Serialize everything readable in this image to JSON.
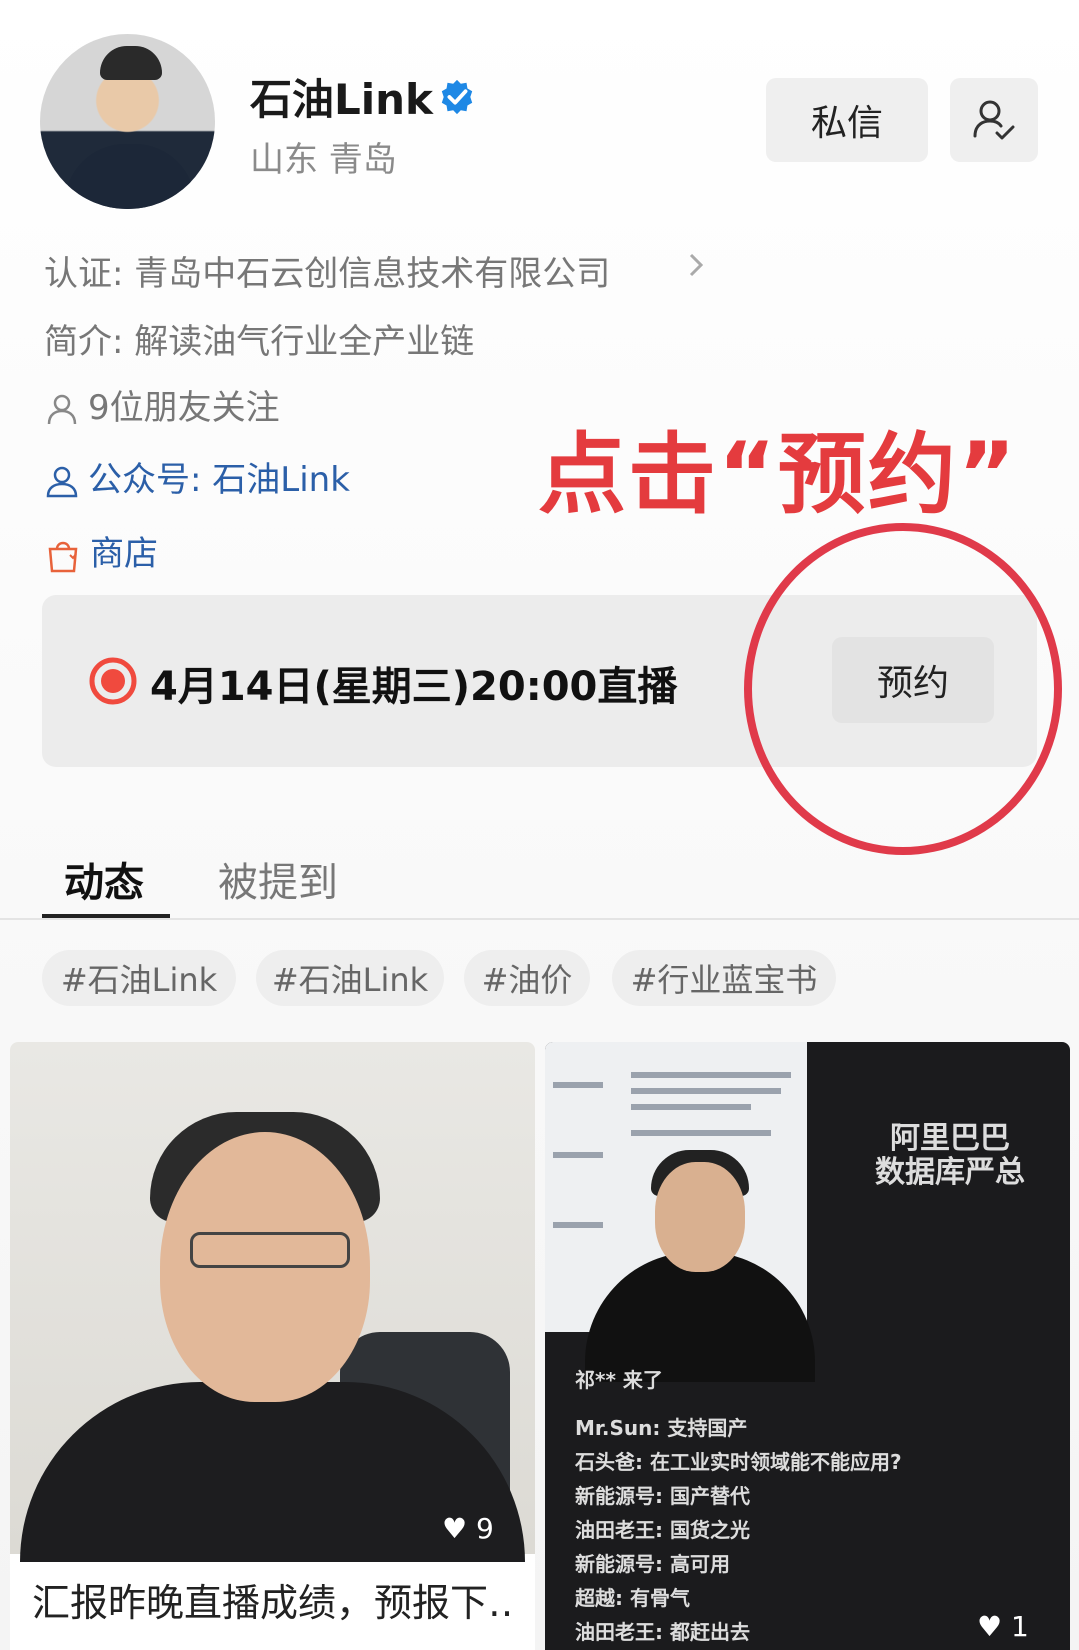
{
  "profile": {
    "name": "石油Link",
    "location": "山东 青岛",
    "message_button": "私信",
    "verification": "认证: 青岛中石云创信息技术有限公司",
    "intro": "简介: 解读油气行业全产业链",
    "friends_follow": "9位朋友关注",
    "official_account": "公众号: 石油Link",
    "shop": "商店"
  },
  "annotation": {
    "text": "点击“预约”",
    "color": "#e43b3e"
  },
  "live": {
    "schedule": "4月14日(星期三)20:00直播",
    "reserve_button": "预约"
  },
  "tabs": [
    {
      "label": "动态",
      "active": true
    },
    {
      "label": "被提到",
      "active": false
    }
  ],
  "tags": [
    "#石油Link",
    "#石油Link",
    "#油价",
    "#行业蓝宝书"
  ],
  "videos": [
    {
      "caption": "汇报昨晚直播成绩，预报下…",
      "likes": "9"
    },
    {
      "likes": "1",
      "overlay_title": [
        "阿里巴巴",
        "数据库严总"
      ],
      "comments": [
        "祁** 来了",
        "Mr.Sun: 支持国产",
        "石头爸: 在工业实时领域能不能应用?",
        "新能源号: 国产替代",
        "油田老王: 国货之光",
        "新能源号: 高可用",
        "超越: 有骨气",
        "油田老王: 都赶出去"
      ]
    }
  ],
  "colors": {
    "verified_badge": "#1e88e5",
    "live_dot": "#f04a3e",
    "annotation_circle": "#e03a4a",
    "link_blue": "#2b5fa8",
    "shop_orange": "#e8623a"
  }
}
